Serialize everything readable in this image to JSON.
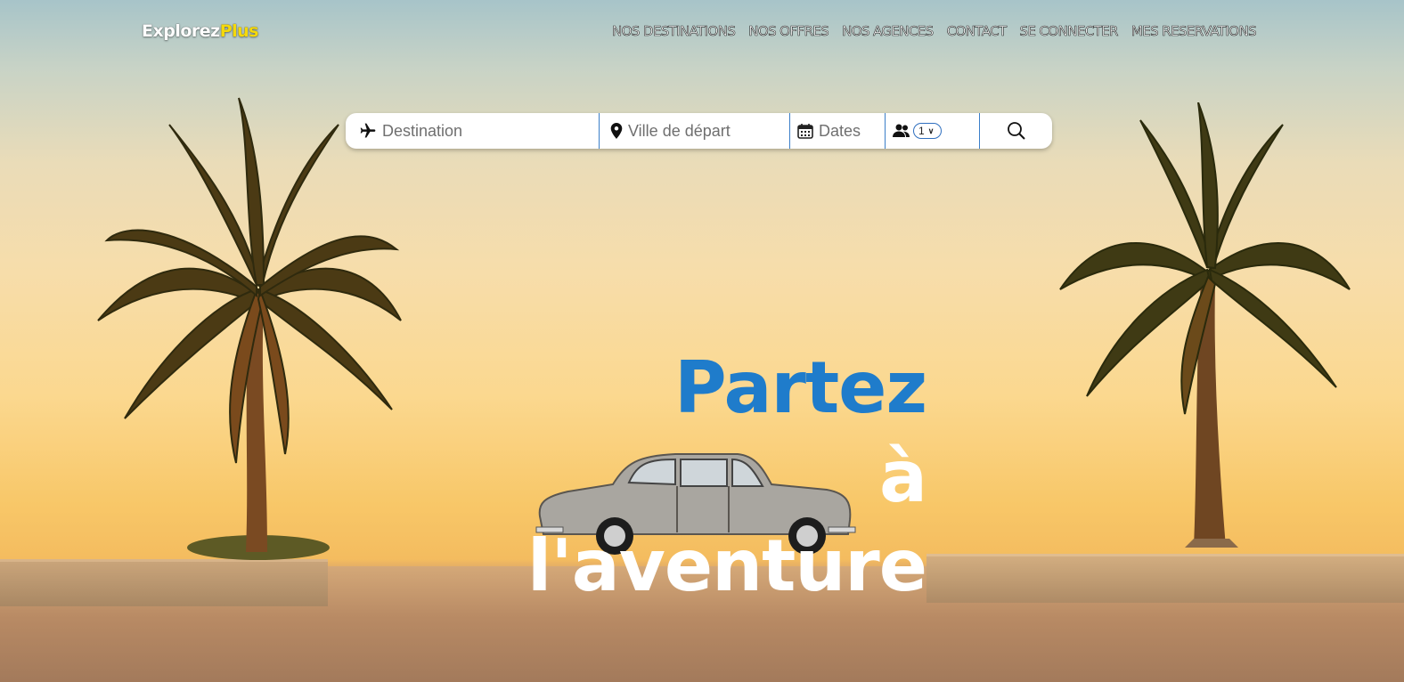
{
  "brand": {
    "name_part1": "Explorez",
    "name_part2": "Plus",
    "accent_color": "#f5d90a"
  },
  "nav": {
    "items": [
      {
        "label": "NOS DESTINATIONS"
      },
      {
        "label": "NOS OFFRES"
      },
      {
        "label": "NOS AGENCES"
      },
      {
        "label": "CONTACT"
      },
      {
        "label": "SE CONNECTER"
      },
      {
        "label": "MES RESERVATIONS"
      }
    ]
  },
  "search": {
    "destination_placeholder": "Destination",
    "destination_icon": "airplane-icon",
    "ville_placeholder": "Ville de départ",
    "ville_icon": "map-pin-icon",
    "dates_placeholder": "Dates",
    "dates_icon": "calendar-icon",
    "persons_icon": "users-icon",
    "persons_value": "1",
    "submit_icon": "search-icon",
    "border_color": "#3b7fc9"
  },
  "hero": {
    "line1": "Partez",
    "line2": "à",
    "line3": "l'aventure",
    "line1_color": "#1f7ccb",
    "other_color": "#ffffff"
  }
}
